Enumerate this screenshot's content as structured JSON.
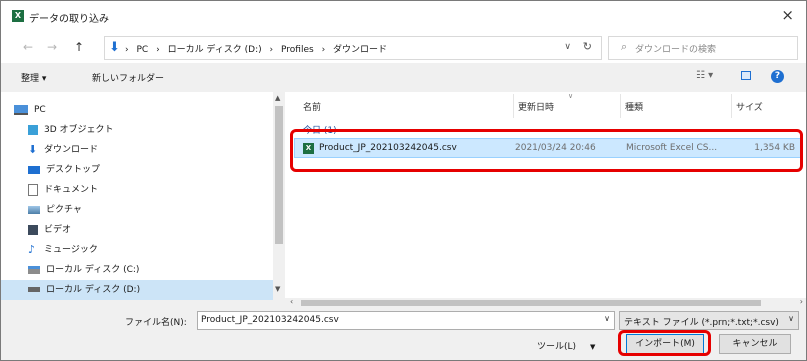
{
  "window": {
    "title": "データの取り込み",
    "close": "×"
  },
  "nav": {
    "back": "←",
    "forward": "→",
    "up": "↑",
    "breadcrumbs": [
      "PC",
      "›",
      "ローカル ディスク (D:)",
      "›",
      "Profiles",
      "›",
      "ダウンロード"
    ],
    "lead_sep": "›",
    "dropdown": "∨",
    "refresh": "↻"
  },
  "search": {
    "placeholder": "ダウンロードの検索"
  },
  "toolbar": {
    "organize": "整理 ▾",
    "new_folder": "新しいフォルダー",
    "view": "☷ ▾",
    "help": "?"
  },
  "sidebar": {
    "items": [
      {
        "label": "PC",
        "icon": "pc-icon"
      },
      {
        "label": "3D オブジェクト",
        "icon": "cube-icon"
      },
      {
        "label": "ダウンロード",
        "icon": "download-arrow-icon"
      },
      {
        "label": "デスクトップ",
        "icon": "desktop-icon"
      },
      {
        "label": "ドキュメント",
        "icon": "document-icon"
      },
      {
        "label": "ピクチャ",
        "icon": "picture-icon"
      },
      {
        "label": "ビデオ",
        "icon": "video-icon"
      },
      {
        "label": "ミュージック",
        "icon": "music-note-icon"
      },
      {
        "label": "ローカル ディスク (C:)",
        "icon": "drive-icon"
      },
      {
        "label": "ローカル ディスク (D:)",
        "icon": "drive-icon",
        "selected": true
      }
    ]
  },
  "columns": {
    "name": "名前",
    "date": "更新日時",
    "type": "種類",
    "size": "サイズ"
  },
  "group_label": "今日 (1)",
  "file": {
    "icon_text": "X",
    "name": "Product_JP_202103242045.csv",
    "date": "2021/03/24 20:46",
    "type": "Microsoft Excel CS...",
    "size": "1,354 KB"
  },
  "bottom": {
    "filename_label": "ファイル名(N):",
    "filename_value": "Product_JP_202103242045.csv",
    "filetype_value": "テキスト ファイル (*.prn;*.txt;*.csv)",
    "tools_label": "ツール(L)",
    "import_label": "インポート(M)",
    "cancel_label": "キャンセル"
  },
  "colors": {
    "highlight": "#e60000",
    "accent": "#1e6fd1",
    "selection": "#cce8ff"
  }
}
